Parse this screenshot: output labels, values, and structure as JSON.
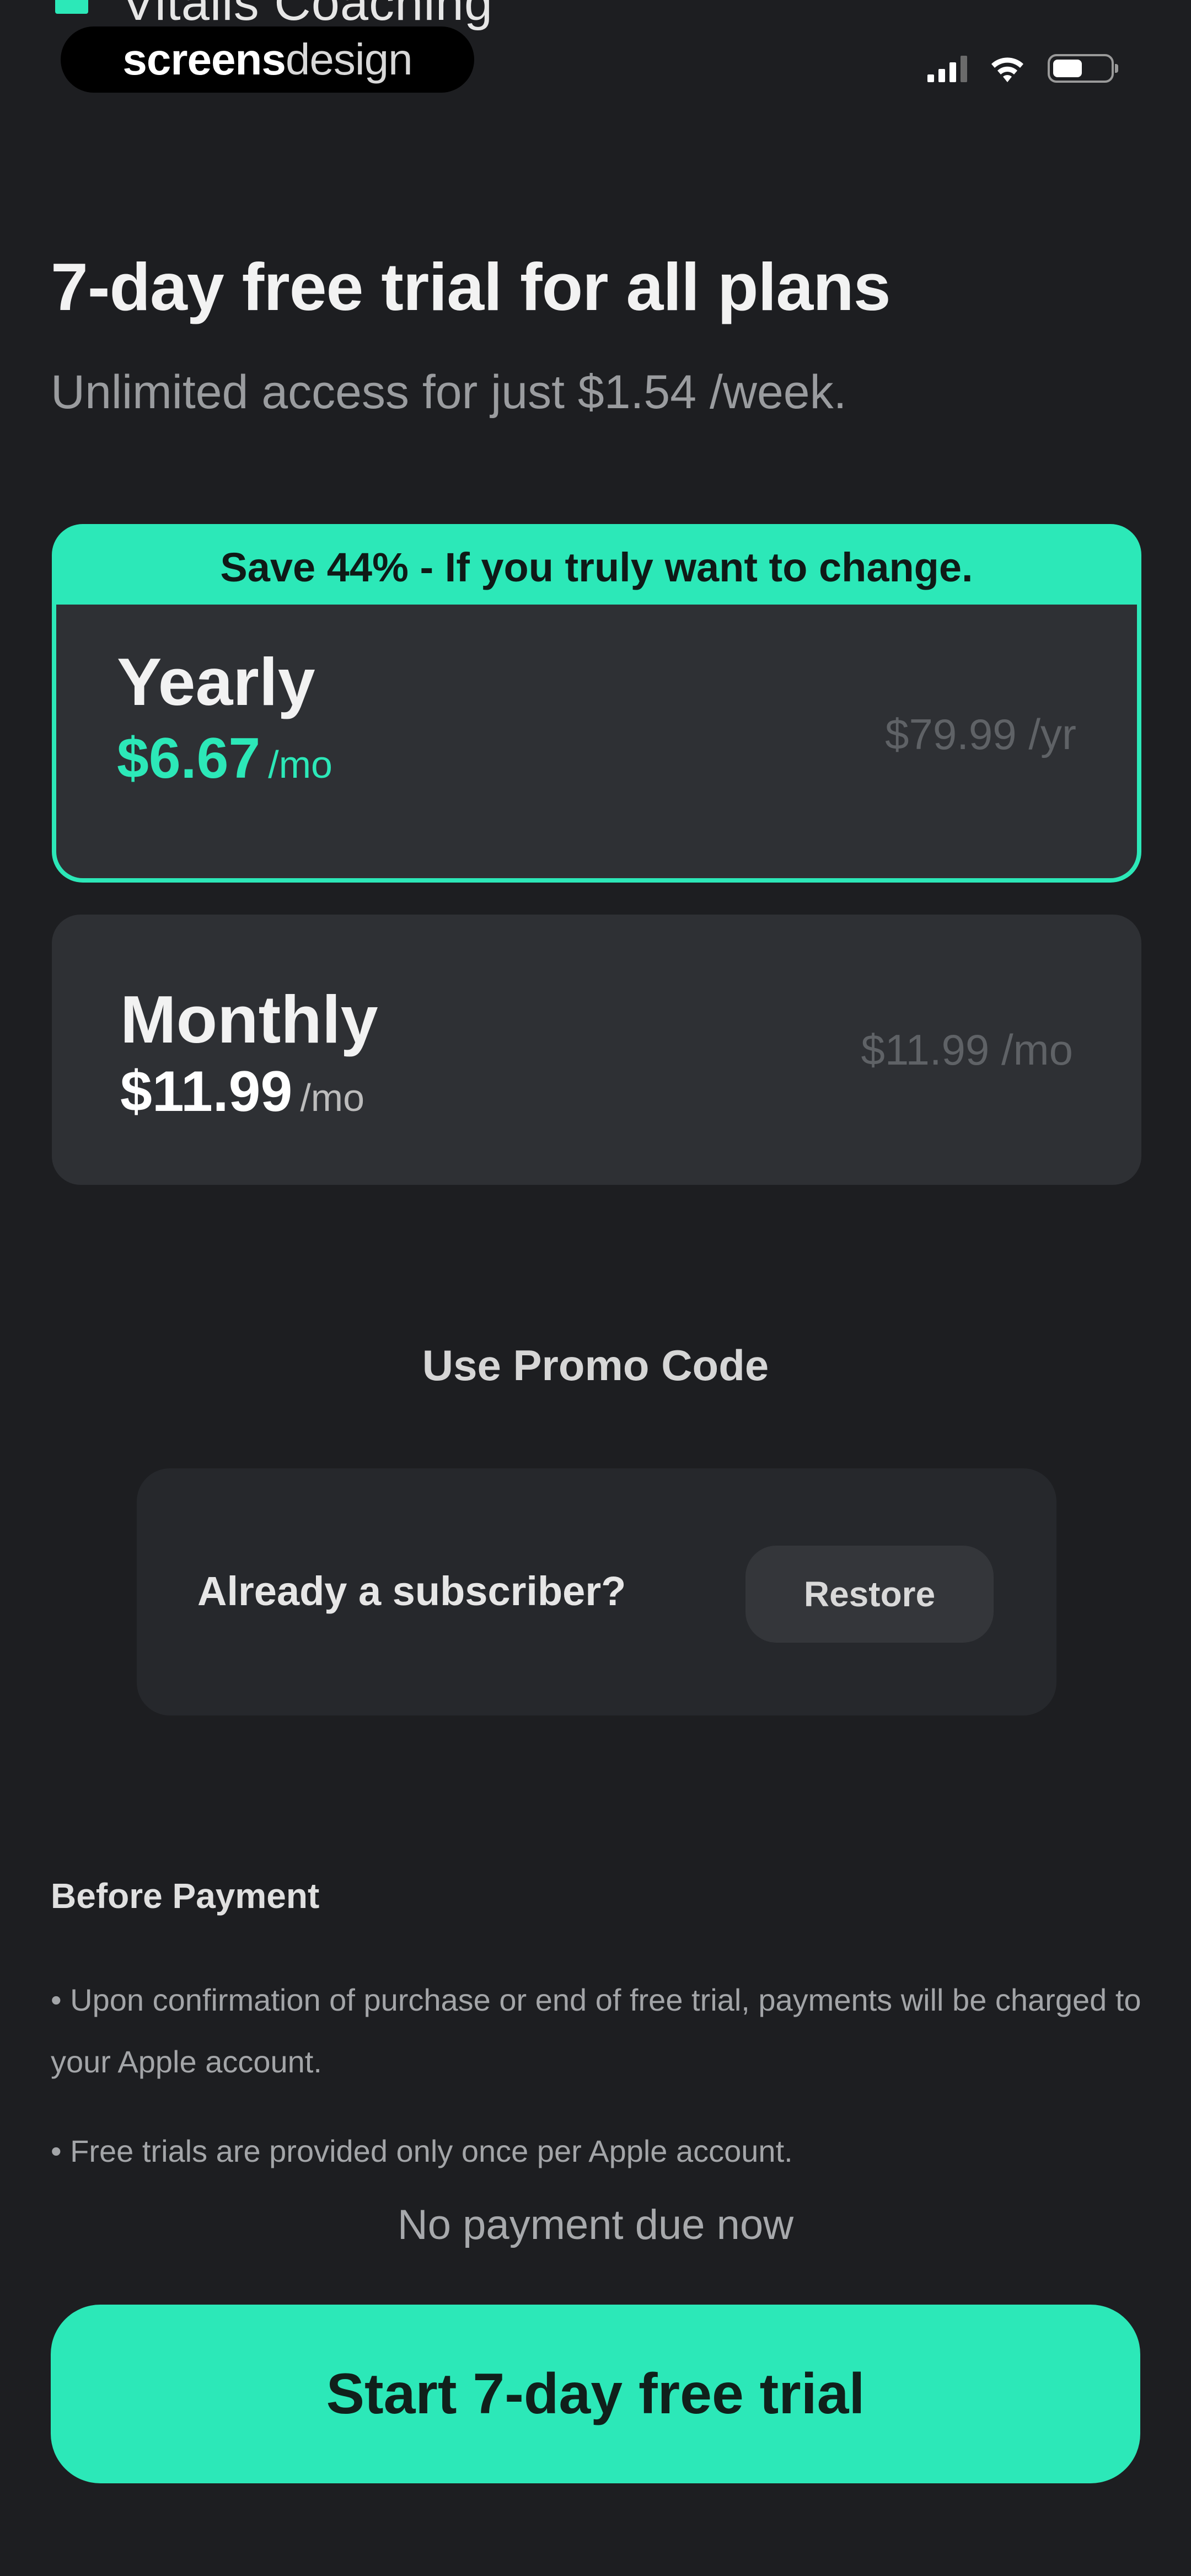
{
  "top_app_hint": "Vitalis Coaching",
  "watermark": {
    "part1": "screens",
    "part2": "design"
  },
  "header": {
    "title": "7-day free trial for all plans",
    "subtitle": "Unlimited access for just $1.54 /week."
  },
  "plans": [
    {
      "selected": true,
      "badge": "Save 44% - If you truly want to change.",
      "name": "Yearly",
      "price": "$6.67",
      "price_unit": "/mo",
      "total": "$79.99 /yr"
    },
    {
      "selected": false,
      "name": "Monthly",
      "price": "$11.99",
      "price_unit": "/mo",
      "total": "$11.99 /mo"
    }
  ],
  "promo_label": "Use Promo Code",
  "restore": {
    "label": "Already a subscriber?",
    "button": "Restore"
  },
  "before_payment": {
    "title": "Before Payment",
    "items": [
      "• Upon confirmation of purchase or end of free trial, payments will be charged to your Apple account.",
      "• Free trials are provided only once per Apple account."
    ]
  },
  "no_payment_note": "No payment due now",
  "cta_label": "Start 7-day free trial",
  "colors": {
    "background": "#1d1e21",
    "accent": "#2ce8b8",
    "card": "#2e3034"
  },
  "icons": [
    "cellular-signal-icon",
    "wifi-icon",
    "battery-icon"
  ]
}
